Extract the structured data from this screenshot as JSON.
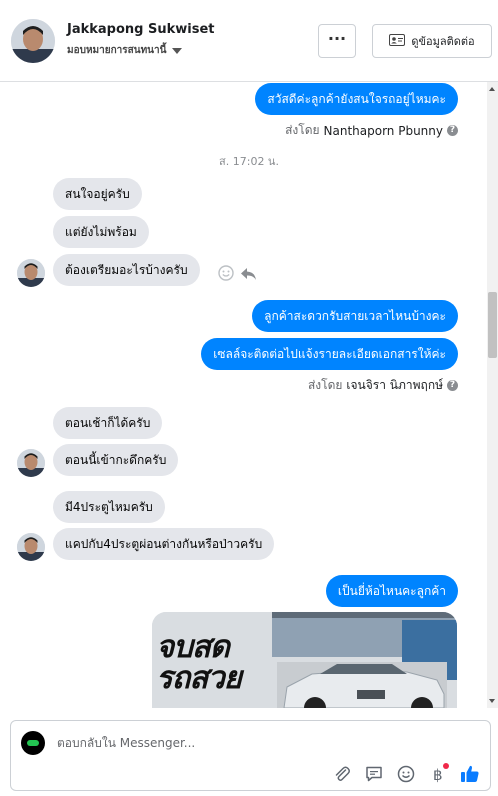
{
  "header": {
    "contact_name": "Jakkapong Sukwiset",
    "assignee_label": "มอบหมายการสนทนานี้",
    "more_label": "···",
    "contact_button_label": "ดูข้อมูลติดต่อ"
  },
  "messages": [
    {
      "text": "สวัสดีค่ะลูกค้ายังสนใจรถอยู่ไหมคะ",
      "from": "page"
    },
    {
      "sent_prefix": "ส่งโดย",
      "sent_by": "Nanthaporn Pbunny"
    },
    {
      "timestamp": "ส. 17:02 น."
    },
    {
      "text": "สนใจอยู่ครับ",
      "from": "contact"
    },
    {
      "text": "แต่ยังไม่พร้อม",
      "from": "contact"
    },
    {
      "text": "ต้องเตรียมอะไรบ้างครับ",
      "from": "contact"
    },
    {
      "text": "ลูกค้าสะดวกรับสายเวลาไหนบ้างคะ",
      "from": "page"
    },
    {
      "text": "เซลล์จะติดต่อไปแจ้งรายละเอียดเอกสารให้ค่ะ",
      "from": "page"
    },
    {
      "sent_prefix": "ส่งโดย",
      "sent_by": "เจนจิรา นิภาพฤกษ์"
    },
    {
      "text": "ตอนเช้าก็ได้ครับ",
      "from": "contact"
    },
    {
      "text": "ตอนนี้เข้ากะดึกครับ",
      "from": "contact"
    },
    {
      "text": "มี4ประตูไหมครับ",
      "from": "contact"
    },
    {
      "text": "แคปกับ4ประตูผ่อนต่างกันหรือป่าวครับ",
      "from": "contact"
    },
    {
      "text": "เป็นยี่ห้อไหนคะลูกค้า",
      "from": "page"
    },
    {
      "image_text_line1": "จบสด",
      "image_text_line2": "รถสวย"
    }
  ],
  "composer": {
    "placeholder": "ตอบกลับใน Messenger..."
  },
  "icons": {
    "more": "more-dots-icon",
    "contact": "contact-card-icon",
    "dropdown": "chevron-down-icon",
    "emoji_react": "smiley-icon",
    "reply": "reply-arrow-icon",
    "help": "question-circle-icon",
    "attach": "paperclip-icon",
    "saved_replies": "chat-bubble-icon",
    "emoji": "emoji-icon",
    "payment": "baht-icon",
    "like": "thumbs-up-icon"
  },
  "colors": {
    "outgoing": "#0084ff",
    "incoming": "#e4e6eb",
    "like": "#0a7cff",
    "notification": "#f02849"
  }
}
